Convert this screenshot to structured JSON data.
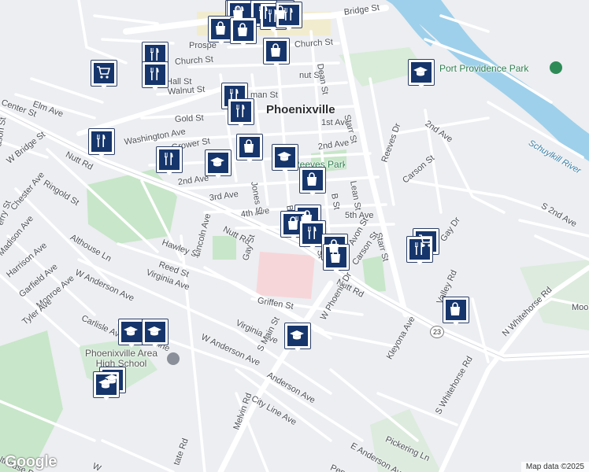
{
  "town": "Phoenixville",
  "attribution": "Map data ©2025",
  "logo": "Google",
  "route_shield": "23",
  "parks": {
    "port_providence": "Port Providence Park",
    "reeves": "Reeves Park"
  },
  "water": "Schuylkill River",
  "school": "Phoenixville Area High School",
  "streets": {
    "bridge_st": "Bridge St",
    "church_st": "Church St",
    "prospect": "Prospe",
    "walnut_st": "Walnut St",
    "walnut_st2": "nut St",
    "hall_st": "Hall St",
    "main_st_top": "man St",
    "gold_st": "Gold St",
    "washington_ave": "Washington Ave",
    "grower_st": "Grower St",
    "second_ave": "2nd Ave",
    "second_ave_east": "2nd Ave",
    "second_ave_far": "2nd Ave",
    "s_second_ave": "S 2nd Ave",
    "first_ave": "1st Ave",
    "third_ave": "3rd Ave",
    "fourth_ave": "4th Ave",
    "fifth_ave": "5th Ave",
    "dean_st": "Dean St",
    "starr_st": "Starr St",
    "starr_st2": "Starr St",
    "jones_st": "Jones St",
    "b_st": "B St",
    "lean_st": "Lean St",
    "reeves_dr": "Reeves Dr",
    "carson_st": "Carson St",
    "carson_st2": "Carson St",
    "nutt_rd_w": "Nutt Rd",
    "nutt_rd_mid": "Nutt Rd",
    "nutt_rd_e": "Nutt Rd",
    "center_st": "Center St",
    "elm_ave": "Elm Ave",
    "w_bridge_st": "W Bridge St",
    "ringold_st": "Ringold St",
    "chester_ave": "Chester Ave",
    "madison_ave": "Madison Ave",
    "harrison_ave": "Harrison Ave",
    "garfield_ave": "Garfield Ave",
    "monroe_ave": "Monroe Ave",
    "tyler_ave": "Tyler Ave",
    "althouse_ln": "Althouse Ln",
    "hawley_st": "Hawley St",
    "lincoln_ave": "Lincoln Ave",
    "reed_st": "Reed St",
    "virginia_ave": "Virginia Ave",
    "w_anderson_ave": "W Anderson Ave",
    "w_anderson_ave2": "W Anderson Ave",
    "gay_st": "Gay St",
    "griffen_st": "Griffen St",
    "virginia_ave2": "Virginia Ave",
    "s_main_st": "S Main St",
    "anderson_ave": "Anderson Ave",
    "city_line_ave": "City Line Ave",
    "city_line_ave2": "City Line",
    "carlisle_ave": "Carlisle Ave",
    "melvin_rd": "Melvin Rd",
    "w_phoenix_dr": "W Phoenix Dr",
    "s_whitehorse_rd": "S Whitehorse Rd",
    "n_whitehorse_rd": "N Whitehorse Rd",
    "valley_rd": "Valley Rd",
    "kleyona_ave": "Kleyona Ave",
    "pickering_ln": "Pickering Ln",
    "e_anderson_ave": "E Anderson Ave",
    "gay_dr": "Gay Dr",
    "buchanan": "Bu",
    "avon_st": "Avon St",
    "moore": "Moor",
    "wason_st": "ason St",
    "tate_rd": "tate Rd",
    "perry_st": "erry St",
    "althouse_rd": "lthouse Rd",
    "w_st": "W",
    "penn": "Penn",
    "st_frag": "St",
    "k_st": "K"
  },
  "markers": [
    {
      "icon": "shopping-bag"
    },
    {
      "icon": "shopping-bag"
    },
    {
      "icon": "restaurant"
    },
    {
      "icon": "restaurant"
    },
    {
      "icon": "shopping-bag"
    },
    {
      "icon": "shopping-bag"
    },
    {
      "icon": "restaurant"
    },
    {
      "icon": "restaurant"
    },
    {
      "icon": "restaurant"
    },
    {
      "icon": "restaurant"
    },
    {
      "icon": "shopping-cart"
    },
    {
      "icon": "shopping-bag"
    },
    {
      "icon": "restaurant"
    },
    {
      "icon": "restaurant"
    },
    {
      "icon": "restaurant"
    },
    {
      "icon": "restaurant"
    },
    {
      "icon": "restaurant"
    },
    {
      "icon": "school"
    },
    {
      "icon": "shopping-bag"
    },
    {
      "icon": "school"
    },
    {
      "icon": "shopping-bag"
    },
    {
      "icon": "shopping-bag"
    },
    {
      "icon": "shopping-bag"
    },
    {
      "icon": "restaurant"
    },
    {
      "icon": "shopping-bag"
    },
    {
      "icon": "shopping-bag"
    },
    {
      "icon": "school"
    },
    {
      "icon": "shopping-cart"
    },
    {
      "icon": "restaurant"
    },
    {
      "icon": "shopping-bag"
    },
    {
      "icon": "school"
    },
    {
      "icon": "school"
    },
    {
      "icon": "school"
    },
    {
      "icon": "school"
    },
    {
      "icon": "school"
    }
  ]
}
